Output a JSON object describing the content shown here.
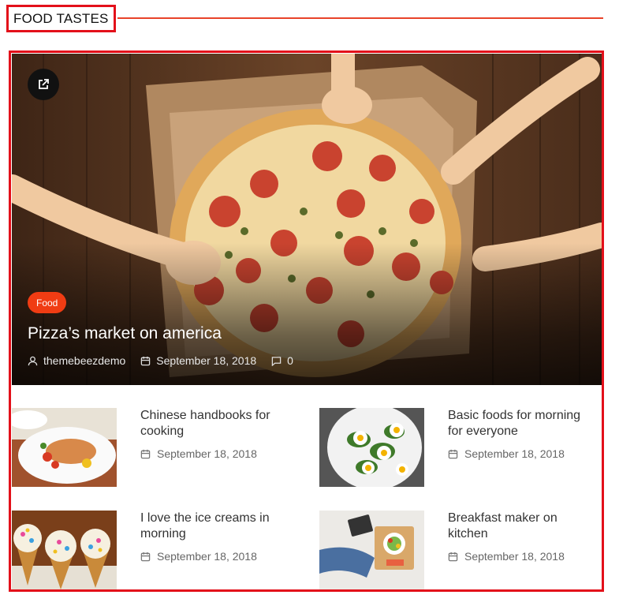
{
  "section": {
    "title": "FOOD TASTES"
  },
  "hero": {
    "category": "Food",
    "title": "Pizza’s market on america",
    "author": "themebeezdemo",
    "date": "September 18, 2018",
    "comments": "0"
  },
  "posts": [
    {
      "title": "Chinese handbooks for cooking",
      "date": "September 18, 2018"
    },
    {
      "title": "Basic foods for morning for everyone",
      "date": "September 18, 2018"
    },
    {
      "title": "I love the ice creams in morning",
      "date": "September 18, 2018"
    },
    {
      "title": "Breakfast maker on kitchen",
      "date": "September 18, 2018"
    }
  ],
  "colors": {
    "accent": "#e3101a",
    "badge": "#f03c13",
    "line": "#e8432a"
  }
}
